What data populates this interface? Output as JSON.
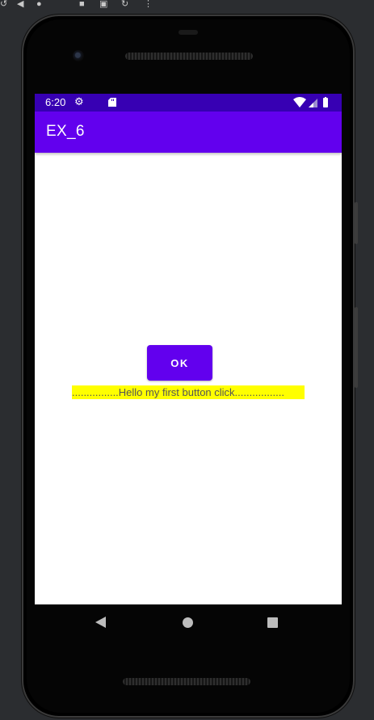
{
  "emulator_toolbar": {
    "icons": [
      "rotate-left-icon",
      "back-icon",
      "home-icon",
      "stop-icon",
      "screenshot-icon",
      "rotate-icon",
      "more-icon"
    ]
  },
  "status_bar": {
    "time": "6:20",
    "icons": [
      "settings-icon",
      "sd-card-icon",
      "wifi-icon",
      "signal-icon",
      "battery-icon"
    ]
  },
  "app_bar": {
    "title": "EX_6"
  },
  "main": {
    "ok_button_label": "OK",
    "message_text": "................Hello my first button click.................",
    "message_bg_color": "#ffff00"
  },
  "colors": {
    "status_bar": "#3700b3",
    "primary": "#6200ee",
    "frame": "#2b2d30"
  }
}
